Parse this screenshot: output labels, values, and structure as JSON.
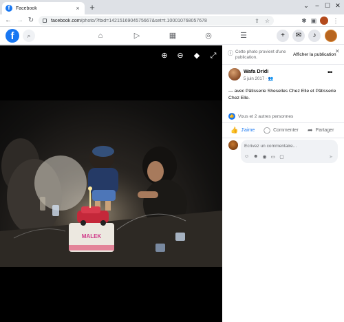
{
  "browser": {
    "tab_title": "Facebook",
    "tab_favicon": "f",
    "url_host": "facebook.com",
    "url_path": "/photo/?fbid=142151690457566​7&set=t.100010768057678",
    "controls": {
      "minimize": "–",
      "maximize": "☐",
      "close": "✕"
    }
  },
  "fb": {
    "logo": "f"
  },
  "panel": {
    "notice_text": "Cette photo provient d'une publication.",
    "notice_link": "Afficher la publication",
    "author": "Wafa Dridi",
    "date": "5 juin 2017",
    "caption_prefix": "— avec ",
    "tag1": "Pâtisserie Sheselles Chez Elle",
    "caption_mid": " et ",
    "tag2": "Pâtisserie Chez Elle",
    "caption_suffix": ".",
    "reactions": "Vous et 2 autres personnes",
    "like_label": "J'aime",
    "comment_label": "Commenter",
    "share_label": "Partager",
    "comment_placeholder": "Écrivez un commentaire..."
  },
  "photo": {
    "cake_text": "MALEK"
  },
  "colors": {
    "brand": "#1877f2",
    "chrome_bg": "#dee1e6",
    "viewer_bg": "#000000",
    "muted_text": "#65676b"
  }
}
